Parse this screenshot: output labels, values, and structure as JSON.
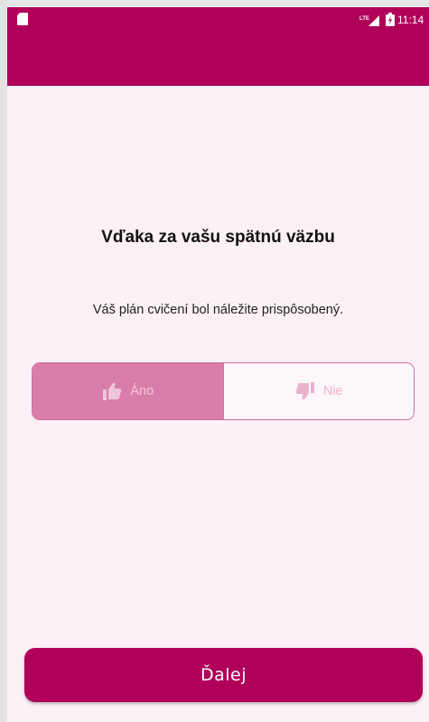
{
  "status_bar": {
    "time": "11:14",
    "icons": [
      "sd-card-icon",
      "lte-signal-icon",
      "battery-charging-icon"
    ]
  },
  "feedback": {
    "title": "Vďaka za vašu spätnú väzbu",
    "message": "Váš plán cvičení bol náležite prispôsobený.",
    "yes_label": "Áno",
    "no_label": "Nie",
    "selected": "yes"
  },
  "footer": {
    "next_label": "Ďalej"
  },
  "colors": {
    "primary": "#b0005a",
    "background": "#fbf1f6",
    "selected_option": "#d97ea9",
    "outline": "#cf6ea0"
  }
}
